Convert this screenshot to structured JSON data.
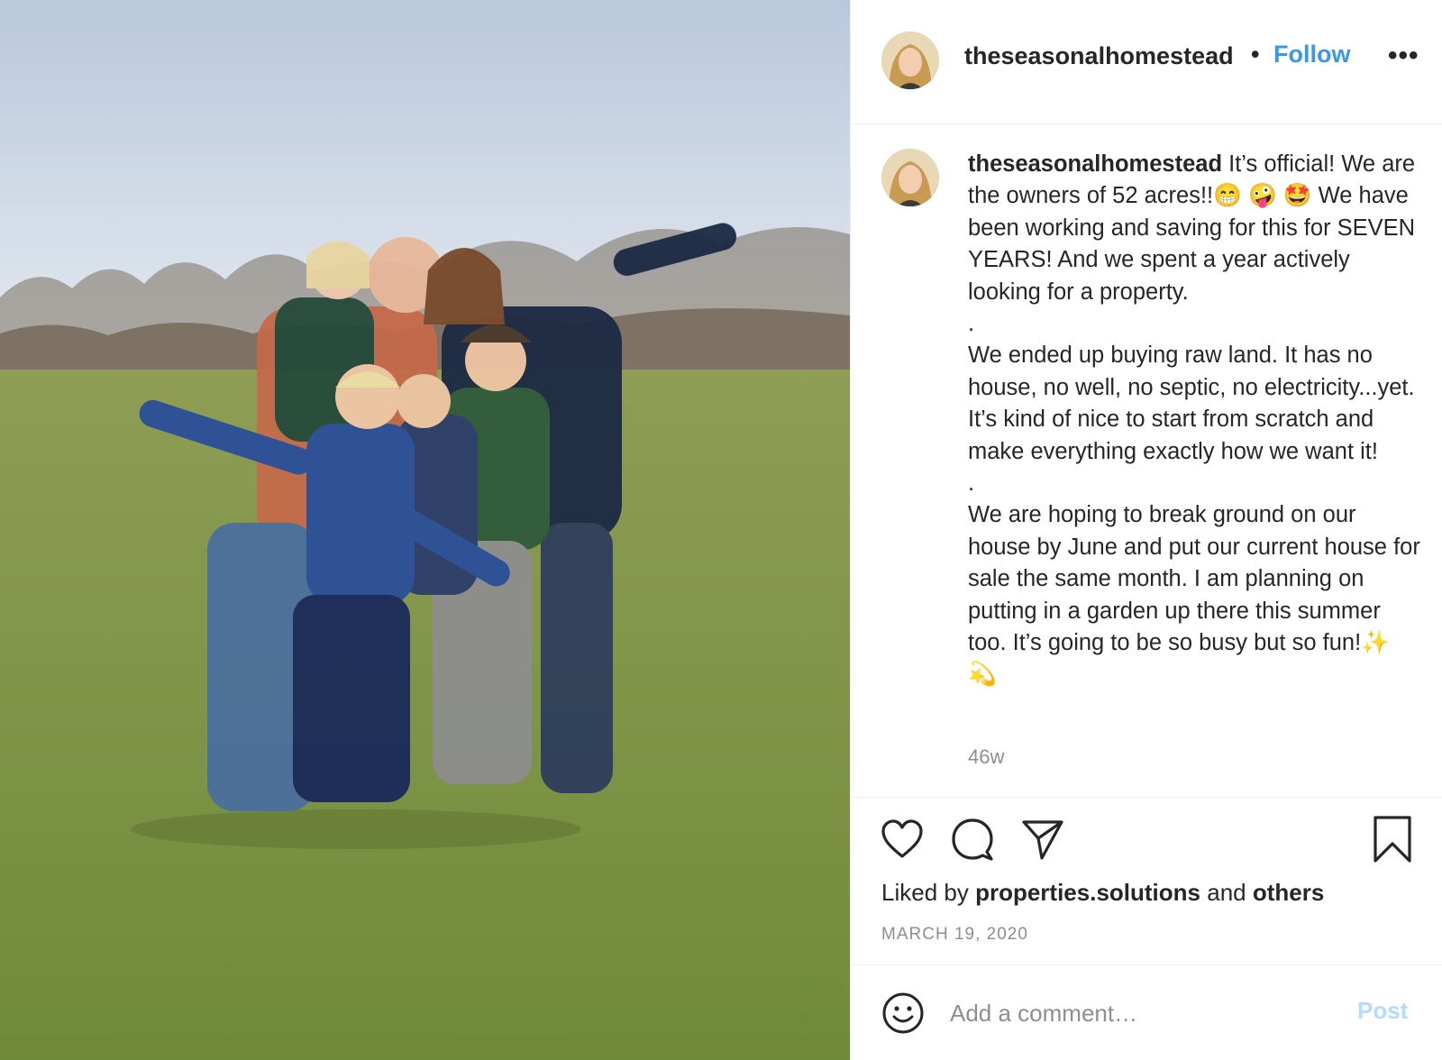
{
  "post": {
    "username": "theseasonalhomestead",
    "follow_separator": "•",
    "follow_label": "Follow",
    "more_label": "•••",
    "caption": {
      "username": "theseasonalhomestead",
      "paragraph_1": "It’s official! We are the owners of 52 acres!!😁 🤪 🤩 We have been working and saving for this for SEVEN YEARS! And we spent a year actively looking for a property.",
      "separator_1": ".",
      "paragraph_2": "We ended up buying raw land. It has no house, no well, no septic, no electricity...yet. It’s kind of nice to start from scratch and make everything exactly how we want it!",
      "separator_2": ".",
      "paragraph_3": "We are hoping to break ground on our house by June and put our current house for sale the same month. I am planning on putting in a garden up there this summer too. It’s going to be so busy but so fun!✨ 💫"
    },
    "time_ago": "46w",
    "liked_by_prefix": "Liked by",
    "liked_by_user": "properties.solutions",
    "liked_by_and": "and",
    "liked_by_others": "others",
    "date": "MARCH 19, 2020",
    "comment_placeholder": "Add a comment…",
    "post_button": "Post"
  },
  "icons": {
    "like": "heart-icon",
    "comment": "comment-icon",
    "share": "share-icon",
    "save": "bookmark-icon",
    "emoji": "emoji-icon",
    "more": "more-options-icon"
  },
  "colors": {
    "follow": "#3897f0",
    "post_disabled": "#b3dbff",
    "secondary_text": "#8e8e8e",
    "primary_text": "#262626",
    "divider": "#efefef"
  }
}
